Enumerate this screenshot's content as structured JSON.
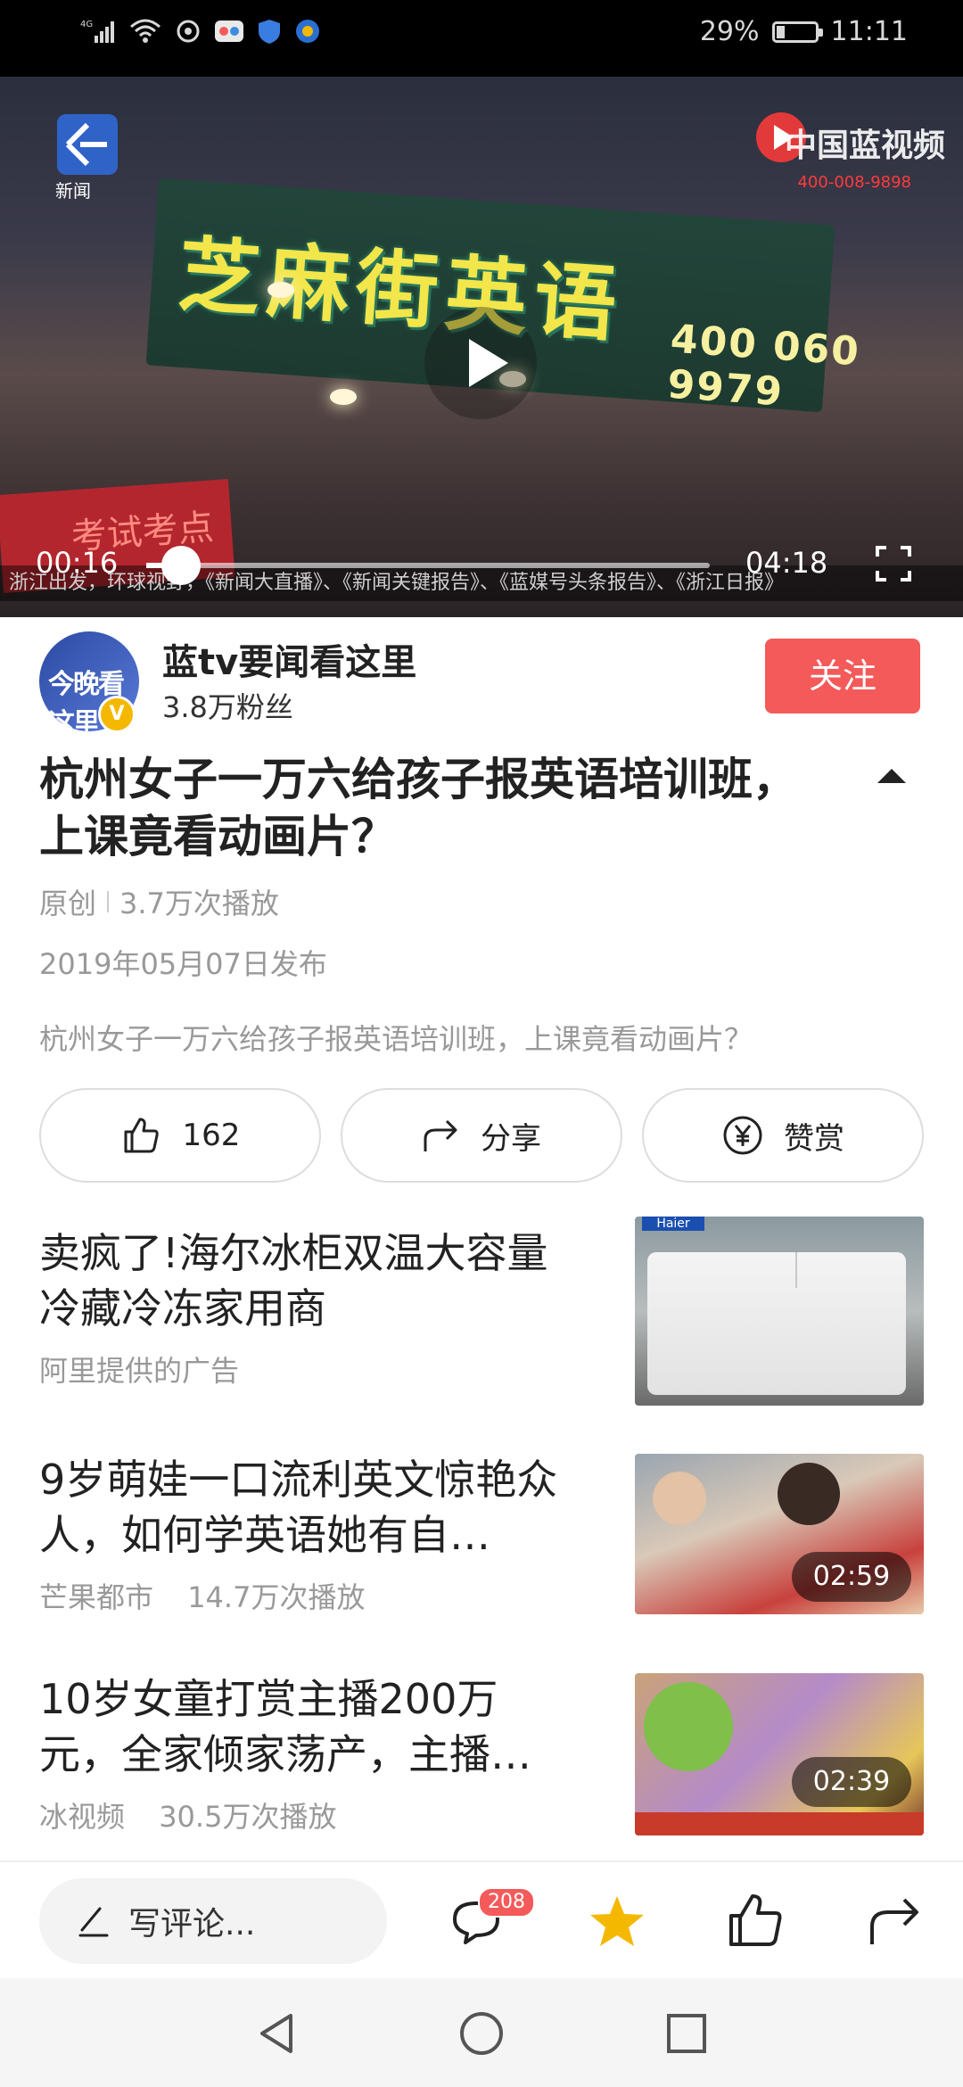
{
  "status_bar": {
    "network": "4G",
    "battery_percent_text": "29%",
    "battery_level": 0.29,
    "time": "11:11"
  },
  "video": {
    "current_time": "00:16",
    "total_time": "04:18",
    "progress_fraction": 0.062,
    "channel_logo_text": "新闻",
    "watermark_text": "中国蓝视频",
    "watermark_sub": "400-008-9898",
    "scene_sign_text": "芝麻街英语",
    "scene_sign_phone": "400 060 9979",
    "scene_banner_text": "考试考点",
    "ticker_text": "浙江出发，环球视野，《新闻大直播》、《新闻关键报告》、《蓝媒号头条报告》、《浙江日报》"
  },
  "author": {
    "avatar_text": "今晚看这里",
    "verified_badge": "V",
    "name": "蓝tv要闻看这里",
    "fans": "3.8万粉丝",
    "follow_label": "关注"
  },
  "article": {
    "title": "杭州女子一万六给孩子报英语培训班，上课竟看动画片？",
    "tag": "原创",
    "plays": "3.7万次播放",
    "published": "2019年05月07日发布",
    "description": "杭州女子一万六给孩子报英语培训班，上课竟看动画片？"
  },
  "actions": {
    "like_count": "162",
    "share_label": "分享",
    "reward_label": "赞赏"
  },
  "feed": [
    {
      "title": "卖疯了!海尔冰柜双温大容量冷藏冷冻家用商",
      "meta_source": "阿里提供的广告",
      "meta_plays": "",
      "duration": "",
      "thumb_brand": "Haier"
    },
    {
      "title": "9岁萌娃一口流利英文惊艳众人，如何学英语她有自…",
      "meta_source": "芒果都市",
      "meta_plays": "14.7万次播放",
      "duration": "02:59"
    },
    {
      "title": "10岁女童打赏主播200万元，全家倾家荡产，主播…",
      "meta_source": "冰视频",
      "meta_plays": "30.5万次播放",
      "duration": "02:39"
    }
  ],
  "bottom_bar": {
    "comment_placeholder": "写评论...",
    "comment_count": "208"
  },
  "colors": {
    "accent_red": "#f45a5a",
    "star_yellow": "#f5b800",
    "meta_gray": "#999999"
  }
}
